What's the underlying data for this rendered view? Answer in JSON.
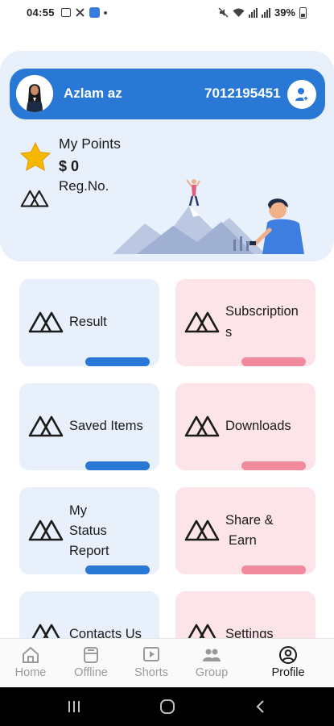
{
  "status_bar": {
    "time": "04:55",
    "battery_pct": "39%",
    "icons": [
      "image-icon",
      "crossed-tools-icon",
      "app-badge-icon",
      "dot-icon",
      "mute-icon",
      "wifi-icon",
      "signal-icon",
      "signal-icon",
      "battery-icon"
    ]
  },
  "profile": {
    "user_name": "Azlam az",
    "phone": "7012195451",
    "points_label": "My Points",
    "points_value": "$ 0",
    "reg_label": "Reg.No."
  },
  "tiles": [
    {
      "label": "Result",
      "color": "#e8f0fc"
    },
    {
      "label": "Subscription s",
      "line1": "Subscription",
      "line2": "s",
      "color": "#fde4e8"
    },
    {
      "label": "Saved Items",
      "color": "#e8f0fc"
    },
    {
      "label": "Downloads",
      "color": "#fde4e8"
    },
    {
      "label": "My Status Report",
      "line1": "My",
      "line2": "Status",
      "line3": "Report",
      "color": "#e8f0fc"
    },
    {
      "label": "Share & Earn",
      "line1": "Share &",
      "line2": "Earn",
      "color": "#fde4e8"
    },
    {
      "label": "Contacts Us",
      "color": "#e8f0fc"
    },
    {
      "label": "Settings",
      "color": "#fde4e8"
    }
  ],
  "bottom_nav": [
    {
      "label": "Home",
      "icon": "home-icon"
    },
    {
      "label": "Offline",
      "icon": "offline-icon"
    },
    {
      "label": "Shorts",
      "icon": "play-icon"
    },
    {
      "label": "Group",
      "icon": "group-icon"
    },
    {
      "label": "Profile",
      "icon": "profile-icon",
      "active": true
    }
  ],
  "colors": {
    "accent_blue": "#2a78d6",
    "panel_blue": "#e8f0fc",
    "tile_pink": "#fde4e8",
    "bar_pink": "#f08a9c",
    "star": "#f5b800"
  }
}
